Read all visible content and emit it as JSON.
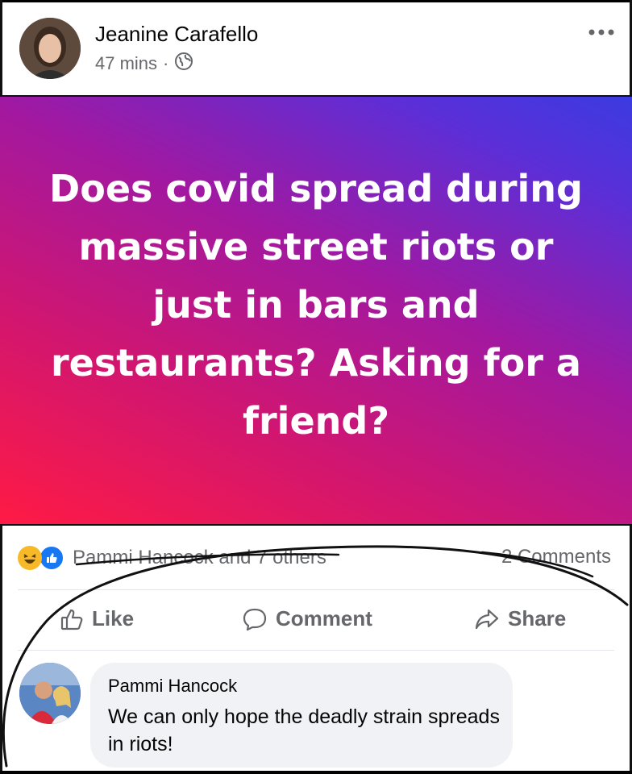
{
  "post": {
    "author": "Jeanine Carafello",
    "time": "47 mins",
    "separator": "·",
    "privacy_icon": "globe-icon",
    "more_icon": "more-options-icon",
    "text": "Does covid spread during massive street riots or just in bars and restaurants? Asking for a friend?",
    "background_colors": [
      "#ff1a44",
      "#a218a0",
      "#3b3be0"
    ]
  },
  "stats": {
    "reaction_icons": [
      "haha-icon",
      "like-icon"
    ],
    "reactors": "Pammi Hancock and 7 others",
    "comments": "2 Comments"
  },
  "actions": {
    "like": "Like",
    "comment": "Comment",
    "share": "Share"
  },
  "comment": {
    "author": "Pammi Hancock",
    "text": "We can only hope the deadly strain spreads in riots!"
  },
  "colors": {
    "secondary_text": "#65676b",
    "comment_bubble": "#f0f2f5",
    "like_blue": "#1877f2",
    "haha_yellow": "#f7b928"
  }
}
